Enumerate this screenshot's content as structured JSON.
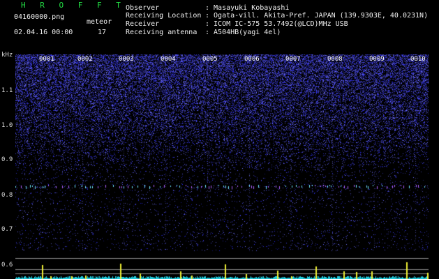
{
  "header": {
    "brand": "H R O F F T",
    "filename": "04160000.png",
    "datetime": "02.04.16 00:00",
    "meteor_label": "meteor",
    "meteor_count": "17",
    "fields": [
      {
        "label": "Observer",
        "value": ": Masayuki Kobayashi"
      },
      {
        "label": "Receiving Location",
        "value": ": Ogata-vill. Akita-Pref. JAPAN (139.9303E, 40.0231N)"
      },
      {
        "label": "Receiver",
        "value": ": ICOM IC-575 53.7492(@LCD)MHz USB"
      },
      {
        "label": "Receiving antenna",
        "value": ": A504HB(yagi 4el)"
      }
    ]
  },
  "axis": {
    "unit": "kHz",
    "ticks": [
      "1.1",
      "1.0",
      "0.9",
      "0.8",
      "0.7",
      "0.6"
    ]
  },
  "minutes": [
    "0001",
    "0002",
    "0003",
    "0004",
    "0005",
    "0006",
    "0007",
    "0008",
    "0009",
    "0010"
  ],
  "colors": {
    "background": "#000000",
    "noise_blue": "#2a2ad0",
    "meteor_trace": "#55ddff",
    "bottom_cyan": "#22ccdd",
    "bottom_spike": "#eeee33",
    "brand_green": "#22dd44"
  }
}
